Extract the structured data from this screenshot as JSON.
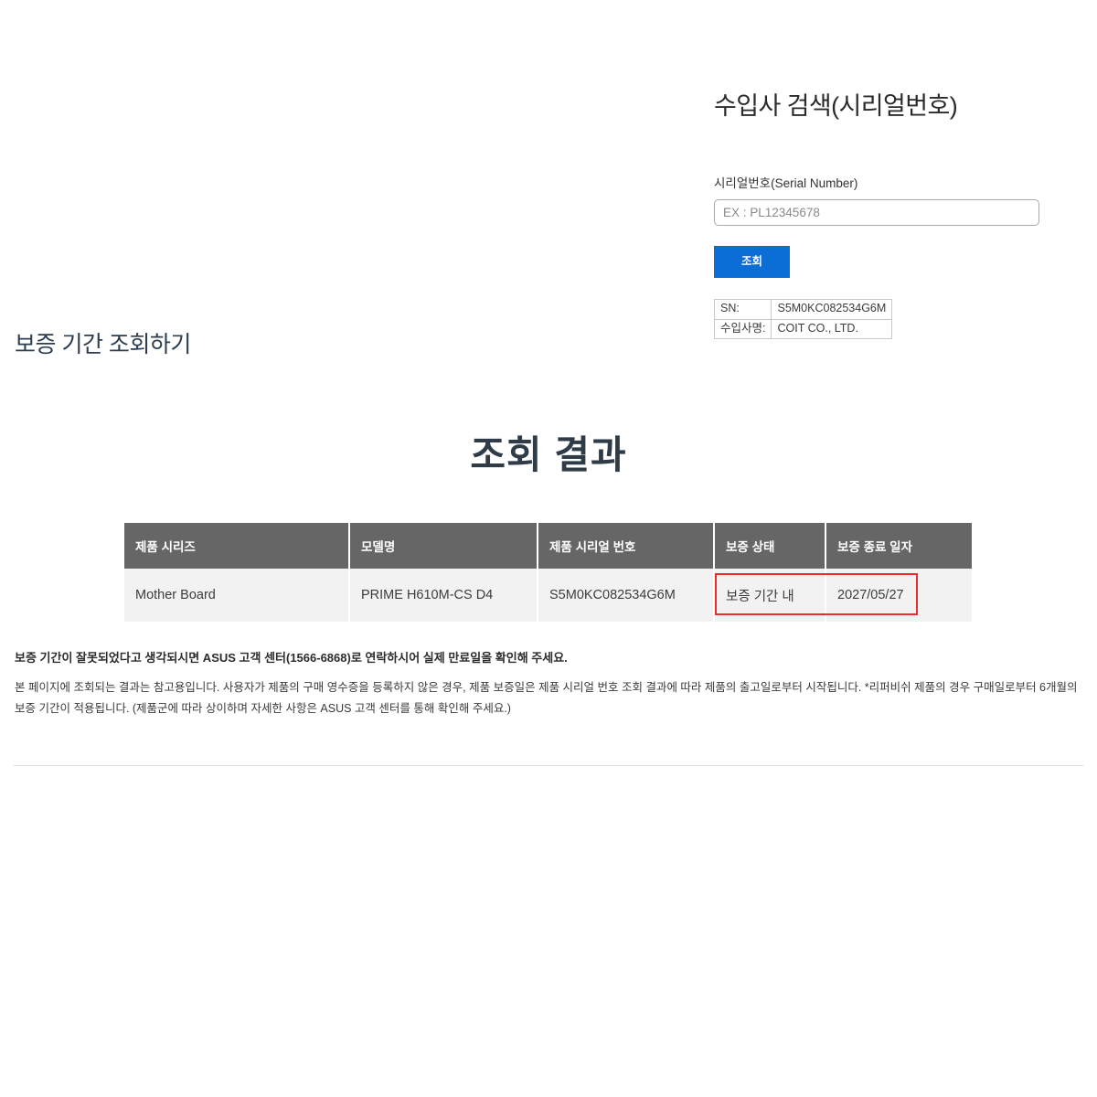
{
  "importer_search": {
    "title": "수입사 검색(시리얼번호)",
    "serial_label": "시리얼번호(Serial Number)",
    "serial_placeholder": "EX : PL12345678",
    "serial_value": "",
    "search_button": "조회",
    "sn_table": {
      "rows": [
        {
          "key": "SN:",
          "value": "S5M0KC082534G6M"
        },
        {
          "key": "수입사명:",
          "value": "COIT CO., LTD."
        }
      ]
    }
  },
  "warranty_lookup": {
    "heading": "보증 기간 조회하기"
  },
  "result": {
    "title": "조회 결과",
    "columns": [
      "제품 시리즈",
      "모델명",
      "제품 시리얼 번호",
      "보증 상태",
      "보증 종료 일자"
    ],
    "rows": [
      {
        "series": "Mother Board",
        "model": "PRIME H610M-CS D4",
        "serial": "S5M0KC082534G6M",
        "status": "보증 기간 내",
        "end_date": "2027/05/27"
      }
    ]
  },
  "notes": {
    "bold": "보증 기간이 잘못되었다고 생각되시면 ASUS 고객 센터(1566-6868)로 연락하시어 실제 만료일을 확인해 주세요.",
    "body": "본 페이지에 조회되는 결과는 참고용입니다. 사용자가 제품의 구매 영수증을 등록하지 않은 경우, 제품 보증일은 제품 시리얼 번호 조회 결과에 따라 제품의 출고일로부터 시작됩니다. *리퍼비쉬 제품의 경우 구매일로부터 6개월의 보증 기간이 적용됩니다. (제품군에 따라 상이하며 자세한 사항은 ASUS 고객 센터를 통해 확인해 주세요.)"
  },
  "colors": {
    "button_blue": "#0b6ed6",
    "table_header_gray": "#666666",
    "table_row_gray": "#f2f2f2",
    "highlight_red": "#ef2b2b"
  }
}
